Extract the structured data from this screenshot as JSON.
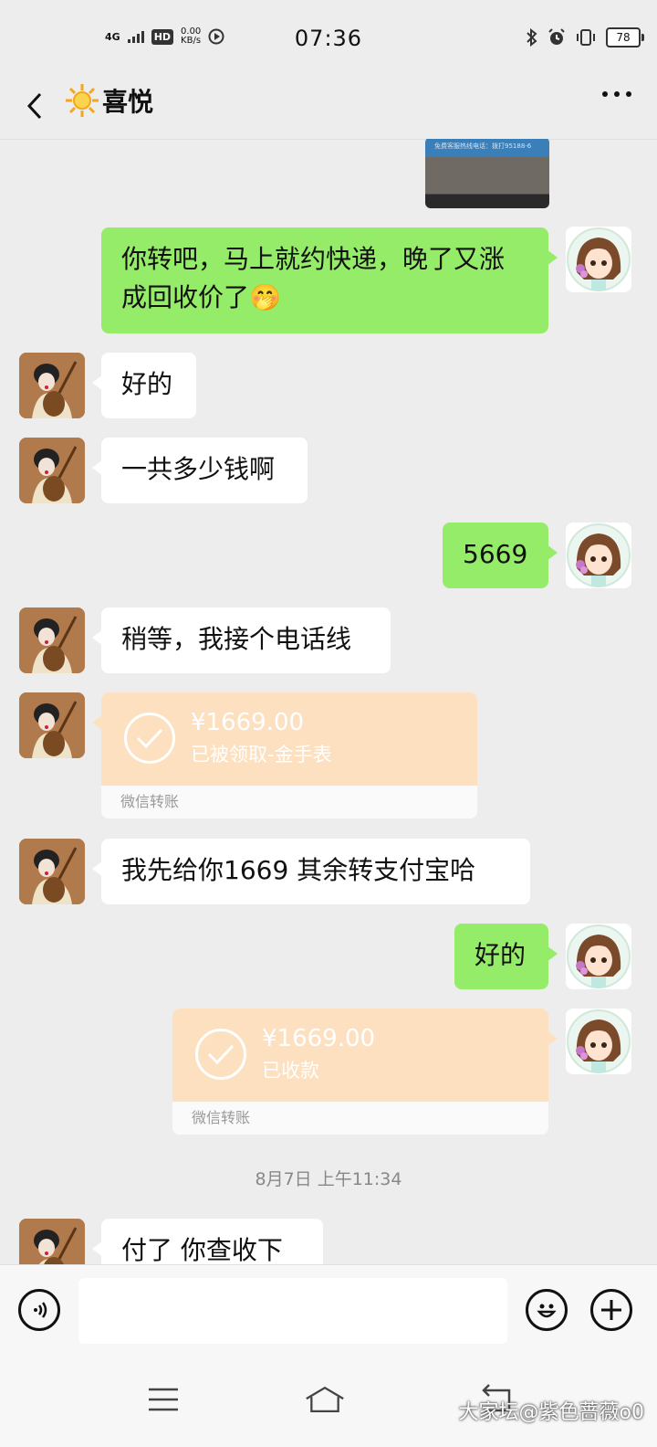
{
  "status_bar": {
    "network": "4G",
    "hd": "HD",
    "speed_value": "0.00",
    "speed_unit": "KB/s",
    "time": "07:36",
    "battery": "78"
  },
  "header": {
    "contact_name": "喜悦"
  },
  "image_message": {
    "caption_text": "免费客服热线电话：拨打95188-6"
  },
  "messages": [
    {
      "from": "me",
      "text": "你转吧，马上就约快递，晚了又涨"
    },
    {
      "from": "me",
      "text_line2": "成回收价了",
      "emoji": "🤭"
    },
    {
      "from": "other",
      "text": "好的"
    },
    {
      "from": "other",
      "text": "一共多少钱啊"
    },
    {
      "from": "me",
      "text": "5669"
    },
    {
      "from": "other",
      "text": "稍等，我接个电话线"
    },
    {
      "from": "other",
      "type": "transfer",
      "amount": "¥1669.00",
      "desc": "已被领取-金手表",
      "footer": "微信转账"
    },
    {
      "from": "other",
      "text": "我先给你1669  其余转支付宝哈"
    },
    {
      "from": "me",
      "text": "好的"
    },
    {
      "from": "me",
      "type": "transfer",
      "amount": "¥1669.00",
      "desc": "已收款",
      "footer": "微信转账"
    },
    {
      "from": "other",
      "text": "付了  你查收下"
    }
  ],
  "timestamp": "8月7日 上午11:34",
  "input": {
    "value": "",
    "placeholder": ""
  },
  "watermark": "大家坛@紫色蔷薇o0",
  "colors": {
    "my_bubble": "#95ec69",
    "other_bubble": "#ffffff",
    "transfer": "#fde0c0",
    "background": "#ededed"
  }
}
